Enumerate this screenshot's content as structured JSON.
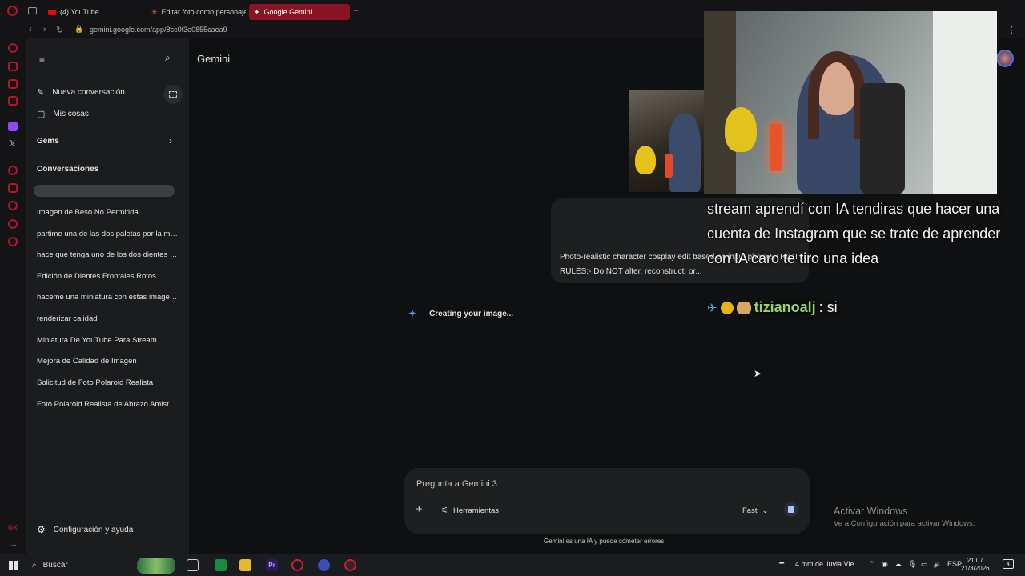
{
  "browser": {
    "tabs": [
      {
        "label": "(4) YouTube"
      },
      {
        "label": "Editar foto como personaje"
      },
      {
        "label": "Google Gemini"
      }
    ],
    "url": "gemini.google.com/app/8cc0f3e0855caea9"
  },
  "sidebar": {
    "new_chat": "Nueva conversación",
    "my_stuff": "Mis cosas",
    "gems": "Gems",
    "conversations_header": "Conversaciones",
    "conversations": [
      "Imagen de Beso No Permitida",
      "partime una de las dos paletas por la mitad",
      "hace que tenga uno de los dos dientes rotos",
      "Edición de Dientes Frontales Rotos",
      "haceme una miniatura con estas imagenes",
      "renderizar calidad",
      "Miniatura De YouTube Para Stream",
      "Mejora de Calidad de Imagen",
      "Solicitud de Foto Polaroid Realista",
      "Foto Polaroid Realista de Abrazo Amistoso"
    ],
    "settings": "Configuración y ayuda"
  },
  "main": {
    "brand": "Gemini",
    "prompt_text": "Photo-realistic character cosplay edit based on input photo.STRICT RULES:- Do NOT alter, reconstruct, or...",
    "status": "Creating your image...",
    "composer_placeholder": "Pregunta a Gemini 3",
    "tools": "Herramientas",
    "mode": "Fast",
    "disclaimer": "Gemini es una IA y puede cometer errores."
  },
  "activate_windows": {
    "title": "Activar Windows",
    "subtitle": "Ve a Configuración para activar Windows."
  },
  "stream_overlay": {
    "chat_message": "stream aprendí con IA tendiras que hacer una cuenta de Instagram que se trate de aprender con IA caro te tiro una idea",
    "chat_user": "tizianoalj",
    "chat_reply": ": si"
  },
  "taskbar": {
    "search": "Buscar",
    "weather": "4 mm de lluvia Vie",
    "language": "ESP",
    "time": "21:07",
    "date": "21/3/2026",
    "notif_count": "4"
  },
  "colors": {
    "accent": "#8a1326",
    "gemini_blue": "#a8c7fa"
  }
}
